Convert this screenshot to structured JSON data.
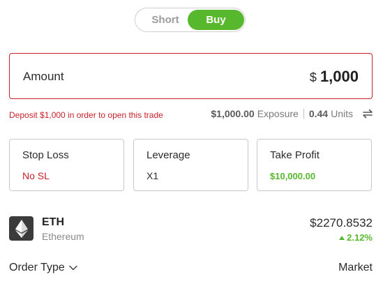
{
  "toggle": {
    "short_label": "Short",
    "buy_label": "Buy",
    "active": "Buy"
  },
  "amount": {
    "label": "Amount",
    "currency": "$",
    "value": "1,000"
  },
  "deposit_notice": "Deposit $1,000 in order to open this trade",
  "exposure": {
    "value": "$1,000.00",
    "label": "Exposure",
    "units_value": "0.44",
    "units_label": "Units"
  },
  "boxes": {
    "stop_loss": {
      "title": "Stop Loss",
      "value": "No SL"
    },
    "leverage": {
      "title": "Leverage",
      "value": "X1"
    },
    "take_profit": {
      "title": "Take Profit",
      "value": "$10,000.00"
    }
  },
  "asset": {
    "symbol": "ETH",
    "name": "Ethereum",
    "price": "$2270.8532",
    "change": "2.12%"
  },
  "order_type": {
    "label": "Order Type",
    "value": "Market"
  },
  "icons": {
    "swap": "swap-arrows-icon",
    "chevron": "chevron-down-icon",
    "logo": "ethereum-logo-icon"
  },
  "colors": {
    "buy_green": "#57b82d",
    "alert_red": "#c8202a"
  }
}
